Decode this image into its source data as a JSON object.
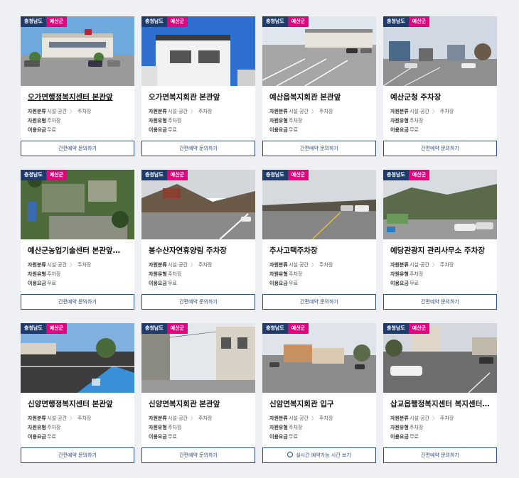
{
  "cards": [
    {
      "region": "충청남도",
      "county": "예산군",
      "title": "오가면행정복지센터 본관앞",
      "cat_label": "자원분류",
      "cat1": "시설·공간",
      "cat2": "주차장",
      "type_label": "자원유형",
      "type": "주차장",
      "fee_label": "이용요금",
      "fee": "무료",
      "button": "간편예약 문의하기"
    },
    {
      "region": "충청남도",
      "county": "예산군",
      "title": "오가면복지회관 본관앞",
      "cat_label": "자원분류",
      "cat1": "시설·공간",
      "cat2": "주차장",
      "type_label": "자원유형",
      "type": "주차장",
      "fee_label": "이용요금",
      "fee": "무료",
      "button": "간편예약 문의하기"
    },
    {
      "region": "충청남도",
      "county": "예산군",
      "title": "예산읍복지회관 본관앞",
      "cat_label": "자원분류",
      "cat1": "시설·공간",
      "cat2": "주차장",
      "type_label": "자원유형",
      "type": "주차장",
      "fee_label": "이용요금",
      "fee": "무료",
      "button": "간편예약 문의하기"
    },
    {
      "region": "충청남도",
      "county": "예산군",
      "title": "예산군청 주차장",
      "cat_label": "자원분류",
      "cat1": "시설·공간",
      "cat2": "주차장",
      "type_label": "자원유형",
      "type": "주차장",
      "fee_label": "이용요금",
      "fee": "무료",
      "button": "간편예약 문의하기"
    },
    {
      "region": "충청남도",
      "county": "예산군",
      "title": "예산군농업기술센터 본관앞…",
      "cat_label": "자원분류",
      "cat1": "시설·공간",
      "cat2": "주차장",
      "type_label": "자원유형",
      "type": "주차장",
      "fee_label": "이용요금",
      "fee": "무료",
      "button": "간편예약 문의하기"
    },
    {
      "region": "충청남도",
      "county": "예산군",
      "title": "봉수산자연휴양림 주차장",
      "cat_label": "자원분류",
      "cat1": "시설·공간",
      "cat2": "주차장",
      "type_label": "자원유형",
      "type": "주차장",
      "fee_label": "이용요금",
      "fee": "무료",
      "button": "간편예약 문의하기"
    },
    {
      "region": "충청남도",
      "county": "예산군",
      "title": "추사고택주차장",
      "cat_label": "자원분류",
      "cat1": "시설·공간",
      "cat2": "주차장",
      "type_label": "자원유형",
      "type": "주차장",
      "fee_label": "이용요금",
      "fee": "무료",
      "button": "간편예약 문의하기"
    },
    {
      "region": "충청남도",
      "county": "예산군",
      "title": "예당관광지 관리사무소 주차장",
      "cat_label": "자원분류",
      "cat1": "시설·공간",
      "cat2": "주차장",
      "type_label": "자원유형",
      "type": "주차장",
      "fee_label": "이용요금",
      "fee": "무료",
      "button": "간편예약 문의하기"
    },
    {
      "region": "충청남도",
      "county": "예산군",
      "title": "신양면행정복지센터 본관앞",
      "cat_label": "자원분류",
      "cat1": "시설·공간",
      "cat2": "주차장",
      "type_label": "자원유형",
      "type": "주차장",
      "fee_label": "이용요금",
      "fee": "무료",
      "button": "간편예약 문의하기"
    },
    {
      "region": "충청남도",
      "county": "예산군",
      "title": "신양면복지회관 본관앞",
      "cat_label": "자원분류",
      "cat1": "시설·공간",
      "cat2": "주차장",
      "type_label": "자원유형",
      "type": "주차장",
      "fee_label": "이용요금",
      "fee": "무료",
      "button": "간편예약 문의하기"
    },
    {
      "region": "충청남도",
      "county": "예산군",
      "title": "신암면복지회관 입구",
      "cat_label": "자원분류",
      "cat1": "시설·공간",
      "cat2": "주차장",
      "type_label": "자원유형",
      "type": "주차장",
      "fee_label": "이용요금",
      "fee": "무료",
      "button": "실시간 예약가능 시간 보기"
    },
    {
      "region": "충청남도",
      "county": "예산군",
      "title": "삽교읍행정복지센터 복지센터…",
      "cat_label": "자원분류",
      "cat1": "시설·공간",
      "cat2": "주차장",
      "type_label": "자원유형",
      "type": "주차장",
      "fee_label": "이용요금",
      "fee": "무료",
      "button": "간편예약 문의하기"
    }
  ],
  "colors": {
    "region_badge": "#1f3b6e",
    "county_badge": "#e4007f",
    "button_border": "#2b4a86"
  }
}
